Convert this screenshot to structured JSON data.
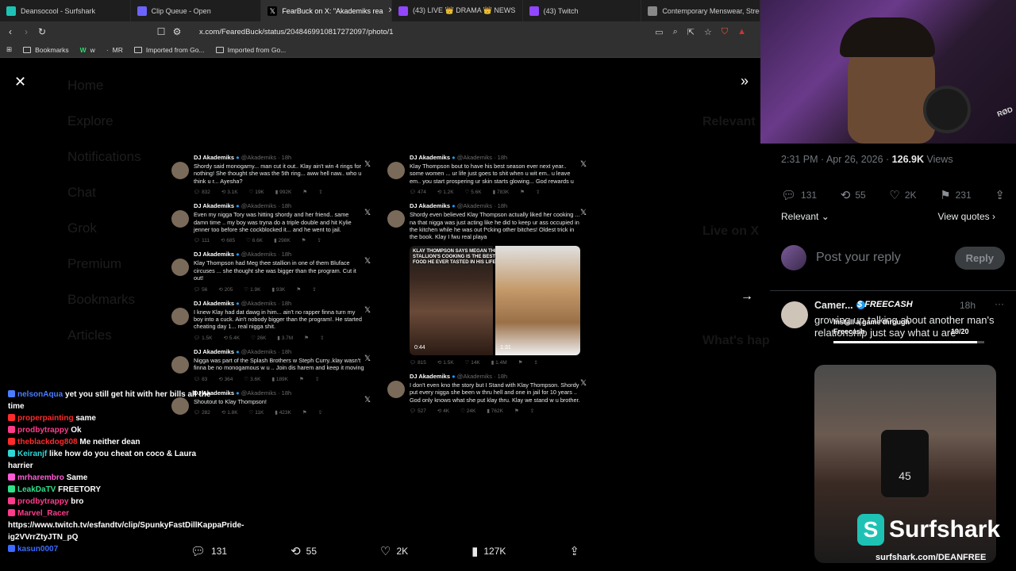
{
  "browser": {
    "tabs": [
      {
        "title": "Deansocool - Surfshark",
        "favicon_color": "#1ec2b4",
        "active": false
      },
      {
        "title": "Clip Queue - Open",
        "favicon_color": "#6c63ff",
        "active": false
      },
      {
        "title": "FearBuck on X: \"Akademiks rea",
        "favicon_color": "#000000",
        "active": true
      },
      {
        "title": "(43) LIVE 👑 DRAMA 👑 NEWS",
        "favicon_color": "#9146ff",
        "active": false
      },
      {
        "title": "(43) Twitch",
        "favicon_color": "#9146ff",
        "active": false
      },
      {
        "title": "Contemporary Menswear, Streetw",
        "favicon_color": "#888888",
        "active": false
      }
    ],
    "url": "x.com/FearedBuck/status/2048469910817272097/photo/1",
    "bookmarks": [
      "Bookmarks",
      "w",
      "MR",
      "Imported from Go...",
      "Imported from Go..."
    ]
  },
  "background_nav": [
    "Home",
    "Explore",
    "Notifications",
    "Chat",
    "Grok",
    "Premium",
    "Bookmarks",
    "Articles"
  ],
  "background_right": [
    "Relevant",
    "Live on X",
    "What's happening"
  ],
  "tweets_left": [
    {
      "name": "DJ Akademiks",
      "handle": "@Akademiks · 18h",
      "text": "Shordy said monogamy... man cut it out.. Klay ain't win 4 rings for nothing! She thought she was the 5th ring... aww hell naw.. who u think u r... Ayesha?",
      "actions": [
        "832",
        "3.1K",
        "19K",
        "992K"
      ]
    },
    {
      "name": "DJ Akademiks",
      "handle": "@Akademiks · 18h",
      "text": "Even my nigga Tory was hitting shordy and her friend.. same damn time .. my boy was tryna do a triple double and hit Kylie jenner too before she cockblocked it... and he went to jail.",
      "actions": "111 685 6.6K 298K"
    },
    {
      "name": "DJ Akademiks",
      "handle": "@Akademiks · 18h",
      "text": "Klay Thompson had Meg thee stallion in one of them Bluface circuses ... she thought she was bigger than the program. Cut it out!",
      "actions": "56 205 1.9K 93K"
    },
    {
      "name": "DJ Akademiks",
      "handle": "@Akademiks · 18h",
      "text": "I knew Klay had dat dawg in him... ain't no rapper finna turn my boy into a cuck. Ain't nobody bigger than the program!. He started cheating day 1... real nigga shit.",
      "actions": "1.5K 5.4K 26K 3.7M"
    },
    {
      "name": "DJ Akademiks",
      "handle": "@Akademiks · 18h",
      "text": "Nigga was part of the Splash Brothers w Steph Curry..klay wasn't finna be no monogamous w u .. Join dis harem and keep it moving",
      "actions": "83 364 3.6K 189K"
    },
    {
      "name": "DJ Akademiks",
      "handle": "@Akademiks · 18h",
      "text": "Shoutout to Klay Thompson!",
      "actions": "282 1.8K 11K 423K"
    }
  ],
  "tweets_right": [
    {
      "name": "DJ Akademiks",
      "handle": "@Akademiks · 18h",
      "text": "Klay Thompson bout to have his best season ever next year.. some women ... ur life just goes to shit when u wit em.. u leave em.. you start prospering ur skin starts glowing... God rewards u",
      "actions": "474 1.2K 5.6K 783K"
    },
    {
      "name": "DJ Akademiks",
      "handle": "@Akademiks · 18h",
      "text": "Shordy even believed Klay Thompson actually liked her cooking ... na that nigga was just acting like he did to keep ur ass occupied in the kitchen while he was out f*cking other bitches! Oldest trick in the book. Klay I fwu real playa",
      "media_caption": "KLAY THOMPSON SAYS MEGAN THEE STALLION'S COOKING IS THE BEST FOOD HE EVER TASTED IN HIS LIFE 😳",
      "media_durations": [
        "0:44",
        "1:31"
      ],
      "actions": "815 1.5K 14K 1.4M"
    },
    {
      "name": "DJ Akademiks",
      "handle": "@Akademiks · 18h",
      "text": "I don't even kno the story but I Stand with Klay Thompson. Shordy put every nigga she been w thru hell and one in jail for 10 years .. God only knows what she put klay thru. Klay we stand w u brother.",
      "actions": "527 4K 24K 762K"
    }
  ],
  "chat": [
    {
      "user": "nelsonAqua",
      "color": "#4a7cff",
      "msg": "yet you still get hit with her bills all the time"
    },
    {
      "user": "properpainting",
      "color": "#ff2a2a",
      "msg": "same"
    },
    {
      "user": "prodbytrappy",
      "color": "#ff3b8b",
      "msg": "Ok"
    },
    {
      "user": "theblackdog808",
      "color": "#ff2a2a",
      "msg": "Me neither dean"
    },
    {
      "user": "Keiranjf",
      "color": "#2fd6d6",
      "msg": "like how do you cheat on coco & Laura harrier"
    },
    {
      "user": "mrharembro",
      "color": "#ff5bd6",
      "msg": "Same"
    },
    {
      "user": "LeakDaTV",
      "color": "#2fe08a",
      "msg": "FREETORY"
    },
    {
      "user": "prodbytrappy",
      "color": "#ff3b8b",
      "msg": "bro"
    },
    {
      "user": "Marvel_Racer",
      "color": "#ff3b8b",
      "msg": "https://www.twitch.tv/esfandtv/clip/SpunkyFastDillKappaPride-ig2VVrrZtyJTN_pQ"
    },
    {
      "user": "kasun0007",
      "color": "#3b6bff",
      "msg": ""
    }
  ],
  "bottom_actions": {
    "replies": "131",
    "reposts": "55",
    "likes": "2K",
    "views": "127K"
  },
  "post": {
    "timestamp": "2:31 PM · Apr 26, 2026 · ",
    "views_count": "126.9K",
    "views_label": "Views",
    "replies": "131",
    "reposts": "55",
    "likes": "2K",
    "bookmarks": "231",
    "sort_label": "Relevant",
    "view_quotes": "View quotes",
    "reply_placeholder": "Post your reply",
    "reply_button": "Reply"
  },
  "reply": {
    "name": "Camer...",
    "time": "18h",
    "text": "growing up talking about another man's relationship just say what u are",
    "jersey_number": "45"
  },
  "overlay": {
    "freecash_brand": "FREECASH",
    "install_text": "Install a game through Freecash",
    "progress_text": "19/20",
    "progress_value": 0.95,
    "surfshark_brand": "Surfshark",
    "surfshark_url": "surfshark.com/DEANFREE",
    "webcam_logo": "RØD"
  },
  "colors": {
    "accent_blue": "#1d9bf0",
    "muted_gray": "#71767b",
    "surfshark_teal": "#1ec2b4"
  }
}
